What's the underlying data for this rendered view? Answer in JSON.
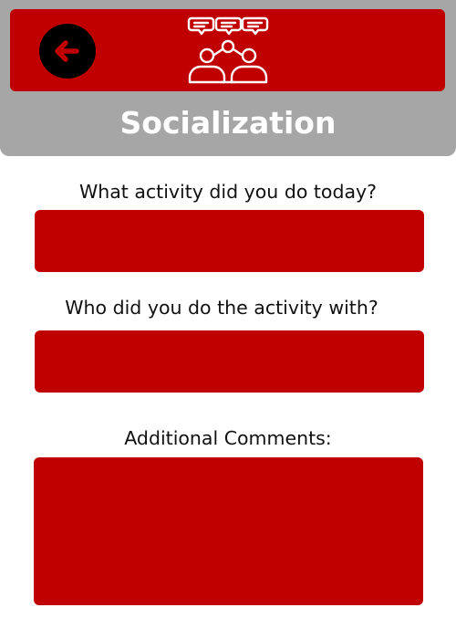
{
  "header": {
    "title": "Socialization",
    "back_icon": "arrow-left-icon",
    "group_icon": "group-chat-icon"
  },
  "form": {
    "activity": {
      "label": "What activity did you do today?",
      "value": "",
      "placeholder": ""
    },
    "companion": {
      "label": "Who did you do the activity with?",
      "value": "",
      "placeholder": ""
    },
    "comments": {
      "label": "Additional Comments:",
      "value": "",
      "placeholder": ""
    }
  },
  "colors": {
    "accent": "#c00000",
    "header_gray": "#a6a6a6",
    "back_button": "#000000"
  }
}
